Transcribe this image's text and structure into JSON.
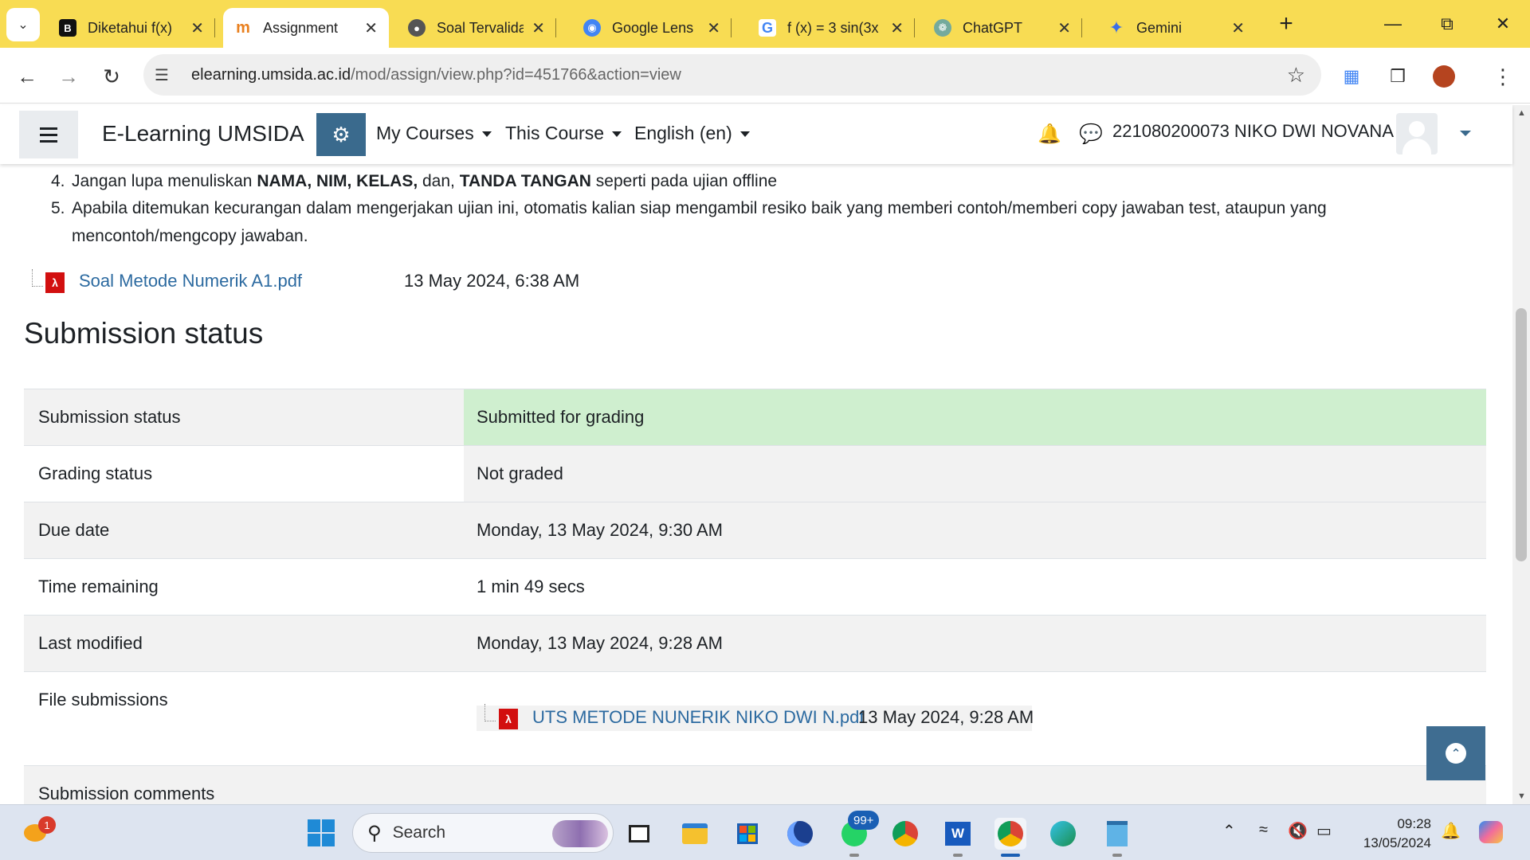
{
  "browser": {
    "tabs": [
      {
        "title": "Diketahui f(x)",
        "favicon": "B"
      },
      {
        "title": "Assignment",
        "favicon": "m"
      },
      {
        "title": "Soal Tervalidasi",
        "favicon": "globe"
      },
      {
        "title": "Google Lens",
        "favicon": "lens"
      },
      {
        "title": "f (x) = 3 sin(3x",
        "favicon": "G"
      },
      {
        "title": "ChatGPT",
        "favicon": "chatgpt"
      },
      {
        "title": "Gemini",
        "favicon": "gemini"
      }
    ],
    "active_tab": 1,
    "url_host": "elearning.umsida.ac.id",
    "url_path": "/mod/assign/view.php?id=451766&action=view",
    "tabstrip_color": "#f8dc53"
  },
  "navbar": {
    "brand": "E-Learning UMSIDA",
    "menus": [
      "My Courses",
      "This Course",
      "English (en)"
    ],
    "username": "221080200073 NIKO DWI NOVANA",
    "accent": "#3a6a8d"
  },
  "rules": {
    "item4_num": "4.",
    "item4_a": "Jangan lupa menuliskan ",
    "item4_b1": "NAMA, NIM, KELAS,",
    "item4_c": " dan, ",
    "item4_b2": "TANDA TANGAN",
    "item4_d": " seperti pada ujian offline",
    "item5_num": "5.",
    "item5_line1": "Apabila ditemukan kecurangan dalam mengerjakan ujian ini, otomatis kalian siap mengambil resiko baik yang memberi contoh/memberi copy jawaban test, ataupun yang",
    "item5_line2": "mencontoh/mengcopy jawaban."
  },
  "attachment": {
    "name": "Soal Metode Numerik A1.pdf",
    "date": "13 May 2024, 6:38 AM"
  },
  "section_title": "Submission status",
  "status_rows": [
    {
      "label": "Submission status",
      "value": "Submitted for grading"
    },
    {
      "label": "Grading status",
      "value": "Not graded"
    },
    {
      "label": "Due date",
      "value": "Monday, 13 May 2024, 9:30 AM"
    },
    {
      "label": "Time remaining",
      "value": "1 min 49 secs"
    },
    {
      "label": "Last modified",
      "value": "Monday, 13 May 2024, 9:28 AM"
    },
    {
      "label": "File submissions",
      "value": ""
    },
    {
      "label": "Submission comments",
      "value": ""
    }
  ],
  "submitted_file": {
    "name": "UTS METODE NUNERIK NIKO DWI N.pdf",
    "date": "13 May 2024, 9:28 AM"
  },
  "status_colors": {
    "submitted": "#cfefcf"
  },
  "taskbar": {
    "search_placeholder": "Search",
    "weather_badge": "1",
    "whatsapp_badge": "99+",
    "time": "09:28",
    "date": "13/05/2024"
  }
}
